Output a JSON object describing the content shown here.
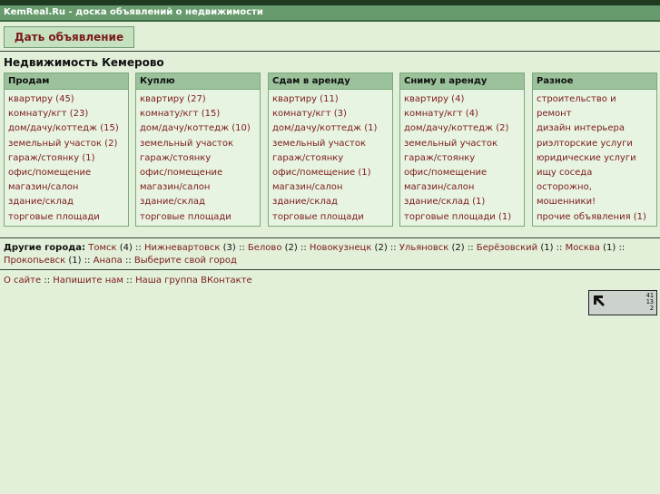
{
  "site_title": "KemReal.Ru - доска объявлений о недвижимости",
  "post_button": "Дать объявление",
  "heading": "Недвижимость Кемерово",
  "columns": [
    {
      "title": "Продам",
      "items": [
        "квартиру (45)",
        "комнату/кгт (23)",
        "дом/дачу/коттедж (15)",
        "земельный участок (2)",
        "гараж/стоянку (1)",
        "офис/помещение",
        "магазин/салон",
        "здание/склад",
        "торговые площади"
      ]
    },
    {
      "title": "Куплю",
      "items": [
        "квартиру (27)",
        "комнату/кгт (15)",
        "дом/дачу/коттедж (10)",
        "земельный участок",
        "гараж/стоянку",
        "офис/помещение",
        "магазин/салон",
        "здание/склад",
        "торговые площади"
      ]
    },
    {
      "title": "Сдам в аренду",
      "items": [
        "квартиру (11)",
        "комнату/кгт (3)",
        "дом/дачу/коттедж (1)",
        "земельный участок",
        "гараж/стоянку",
        "офис/помещение (1)",
        "магазин/салон",
        "здание/склад",
        "торговые площади"
      ]
    },
    {
      "title": "Сниму в аренду",
      "items": [
        "квартиру (4)",
        "комнату/кгт (4)",
        "дом/дачу/коттедж (2)",
        "земельный участок",
        "гараж/стоянку",
        "офис/помещение",
        "магазин/салон",
        "здание/склад (1)",
        "торговые площади (1)"
      ]
    },
    {
      "title": "Разное",
      "items": [
        "строительство и ремонт",
        "дизайн интерьера",
        "риэлторские услуги",
        "юридические услуги",
        "ищу соседа",
        "осторожно, мошенники!",
        "прочие объявления (1)"
      ]
    }
  ],
  "other_cities": {
    "label": "Другие города:",
    "separator": " :: ",
    "cities": [
      {
        "name": "Томск",
        "count": "(4)"
      },
      {
        "name": "Нижневартовск",
        "count": "(3)"
      },
      {
        "name": "Белово",
        "count": "(2)"
      },
      {
        "name": "Новокузнецк",
        "count": "(2)"
      },
      {
        "name": "Ульяновск",
        "count": "(2)"
      },
      {
        "name": "Берёзовский",
        "count": "(1)"
      },
      {
        "name": "Москва",
        "count": "(1)"
      },
      {
        "name": "Прокопьевск",
        "count": "(1)"
      },
      {
        "name": "Анапа",
        "count": ""
      }
    ],
    "choose_link": "Выберите свой город"
  },
  "footer_links": [
    "О сайте",
    "Напишите нам",
    "Наша группа ВКонтакте"
  ],
  "counter": {
    "icon": "liveinternet-arrow-icon",
    "values": [
      "41",
      "13",
      "2"
    ]
  }
}
